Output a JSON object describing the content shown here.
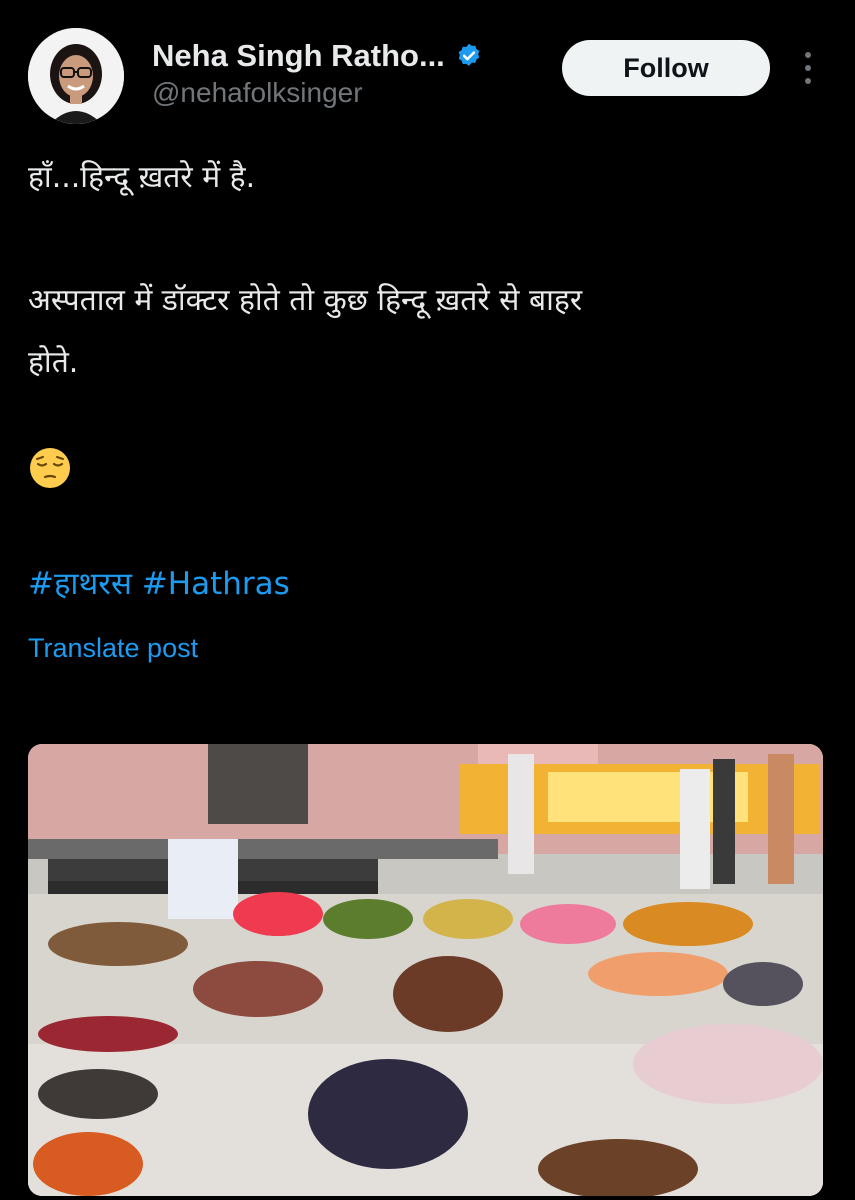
{
  "author": {
    "display_name": "Neha Singh Ratho...",
    "handle": "@nehafolksinger",
    "verified": true,
    "avatar_icon": "profile-photo"
  },
  "actions": {
    "follow_label": "Follow",
    "more_icon": "vertical-ellipsis-icon"
  },
  "post": {
    "lines": [
      "हाँ...हिन्दू ख़तरे में है.",
      "अस्पताल में डॉक्टर होते तो कुछ हिन्दू ख़तरे से बाहर",
      "होते."
    ],
    "emoji": "pensive-face",
    "hashtags": [
      "#हाथरस",
      "#Hathras"
    ],
    "translate_label": "Translate post"
  },
  "media": {
    "type": "photo"
  },
  "colors": {
    "background": "#000000",
    "text": "#e7e9ea",
    "secondary_text": "#71767b",
    "link": "#1d9bf0",
    "verified_badge": "#1d9bf0",
    "follow_button_bg": "#eff3f4"
  }
}
